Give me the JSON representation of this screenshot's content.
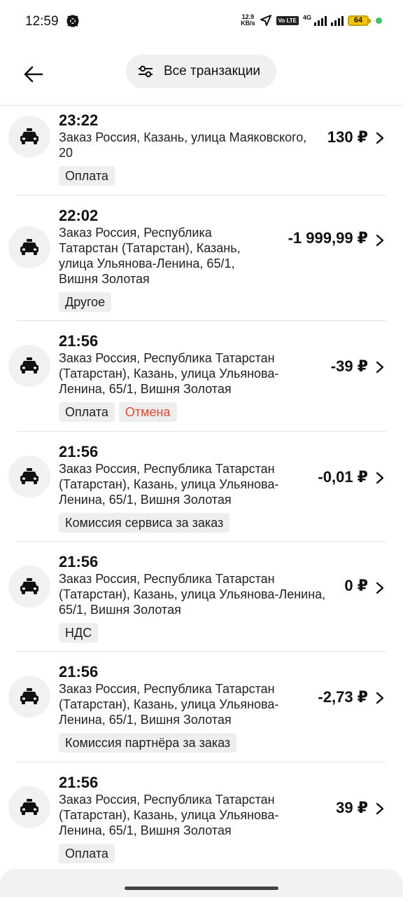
{
  "status_bar": {
    "time": "12:59",
    "speed_value": "12.9",
    "speed_unit": "KB/s",
    "volte": "Vo LTE",
    "network": "4G",
    "battery": "64"
  },
  "header": {
    "back_icon": "arrow-left-icon",
    "filter_icon": "sliders-icon",
    "filter_label": "Все транзакции"
  },
  "transactions": [
    {
      "time": "23:22",
      "desc_lines": [
        "Заказ Россия, Казань, улица Маяковского,",
        "20"
      ],
      "amount": "130 ₽",
      "tags": [
        {
          "label": "Оплата",
          "style": "normal"
        }
      ]
    },
    {
      "time": "22:02",
      "desc_lines": [
        "Заказ Россия, Республика",
        "Татарстан (Татарстан), Казань,",
        "улица Ульянова-Ленина, 65/1,",
        "Вишня Золотая"
      ],
      "amount": "-1 999,99 ₽",
      "tags": [
        {
          "label": "Другое",
          "style": "normal"
        }
      ]
    },
    {
      "time": "21:56",
      "desc_lines": [
        "Заказ Россия, Республика Татарстан",
        "(Татарстан), Казань, улица Ульянова-",
        "Ленина, 65/1, Вишня Золотая"
      ],
      "amount": "-39 ₽",
      "tags": [
        {
          "label": "Оплата",
          "style": "normal"
        },
        {
          "label": "Отмена",
          "style": "red"
        }
      ]
    },
    {
      "time": "21:56",
      "desc_lines": [
        "Заказ Россия, Республика Татарстан",
        "(Татарстан), Казань, улица Ульянова-",
        "Ленина, 65/1, Вишня Золотая"
      ],
      "amount": "-0,01 ₽",
      "tags": [
        {
          "label": "Комиссия сервиса за заказ",
          "style": "normal"
        }
      ]
    },
    {
      "time": "21:56",
      "desc_lines": [
        "Заказ Россия, Республика Татарстан",
        "(Татарстан), Казань, улица Ульянова-Ленина,",
        "65/1, Вишня Золотая"
      ],
      "amount": "0 ₽",
      "tags": [
        {
          "label": "НДС",
          "style": "normal"
        }
      ]
    },
    {
      "time": "21:56",
      "desc_lines": [
        "Заказ Россия, Республика Татарстан",
        "(Татарстан), Казань, улица Ульянова-",
        "Ленина, 65/1, Вишня Золотая"
      ],
      "amount": "-2,73 ₽",
      "tags": [
        {
          "label": "Комиссия партнёра за заказ",
          "style": "normal"
        }
      ]
    },
    {
      "time": "21:56",
      "desc_lines": [
        "Заказ Россия, Республика Татарстан",
        "(Татарстан), Казань, улица Ульянова-",
        "Ленина, 65/1, Вишня Золотая"
      ],
      "amount": "39 ₽",
      "tags": [
        {
          "label": "Оплата",
          "style": "normal"
        }
      ]
    }
  ],
  "icons": {
    "row_icon": "taxi-car-icon",
    "row_chevron": "chevron-right-icon"
  },
  "colors": {
    "cancel_red": "#e24a2f",
    "tag_bg": "#eeeeee",
    "avatar_bg": "#f1f1f1"
  }
}
